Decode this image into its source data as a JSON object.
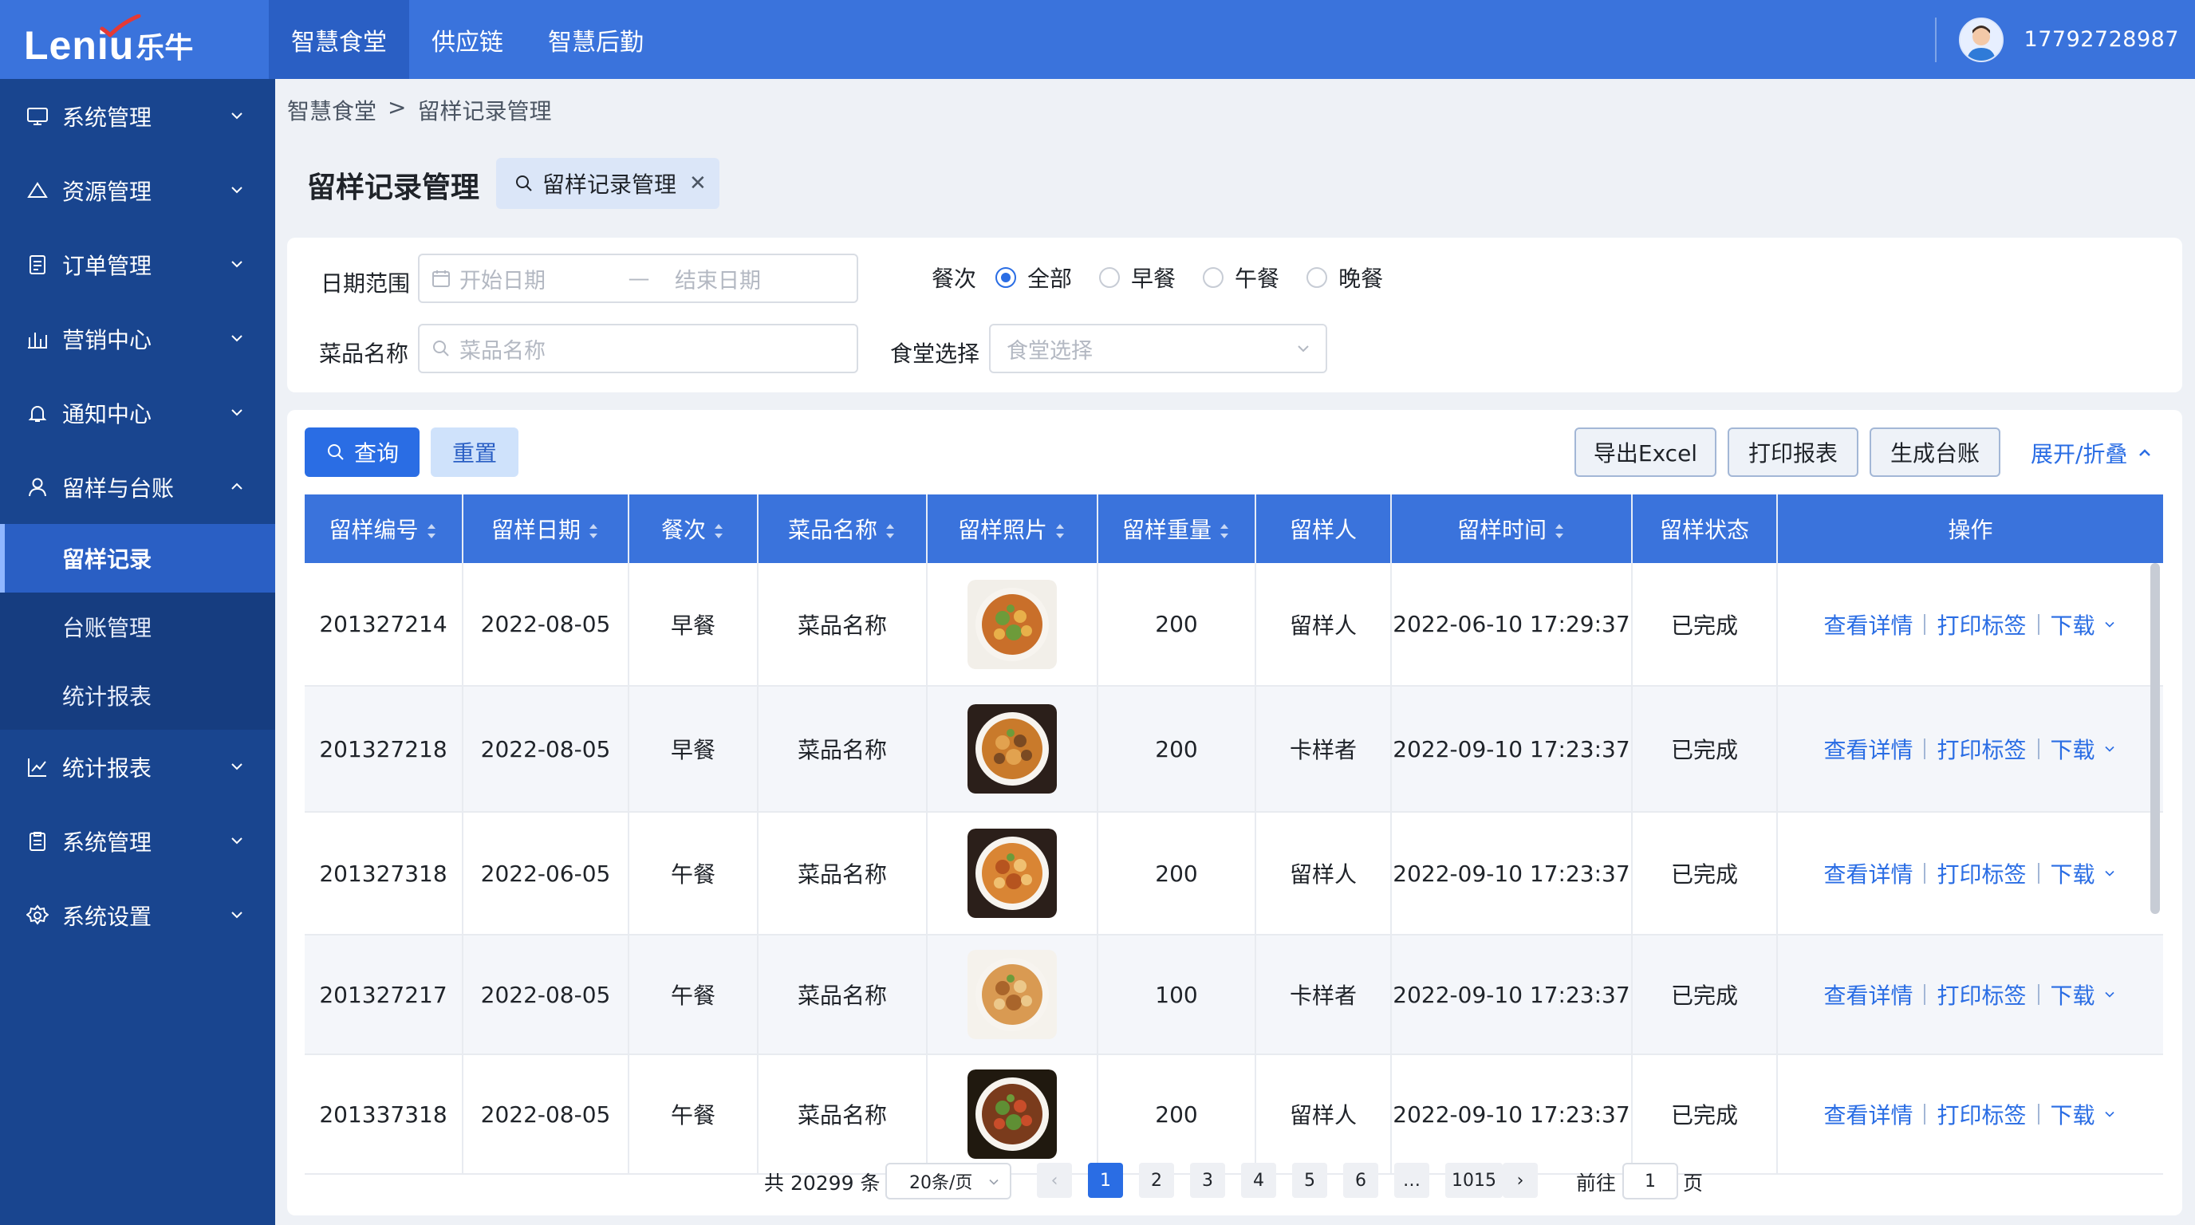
{
  "brand": {
    "latin": "Leniu",
    "cn": "乐牛"
  },
  "topnav": [
    "智慧食堂",
    "供应链",
    "智慧后勤"
  ],
  "user": {
    "phone": "17792728987"
  },
  "sidebar": {
    "items_top": [
      "系统管理",
      "资源管理",
      "订单管理",
      "营销中心",
      "通知中心",
      "留样与台账"
    ],
    "sub_items": [
      "留样记录",
      "台账管理",
      "统计报表"
    ],
    "items_bottom": [
      "统计报表",
      "系统管理",
      "系统设置"
    ]
  },
  "breadcrumb": {
    "root": "智慧食堂",
    "sep": ">",
    "current": "留样记录管理"
  },
  "page": {
    "title": "留样记录管理",
    "tag": "留样记录管理"
  },
  "filters": {
    "date_label": "日期范围",
    "start_placeholder": "开始日期",
    "dash": "—",
    "end_placeholder": "结束日期",
    "meal_label": "餐次",
    "meal_options": [
      "全部",
      "早餐",
      "午餐",
      "晚餐"
    ],
    "meal_selected": "全部",
    "dish_label": "菜品名称",
    "dish_placeholder": "菜品名称",
    "canteen_label": "食堂选择",
    "canteen_placeholder": "食堂选择"
  },
  "actions": {
    "query": "查询",
    "reset": "重置",
    "export": "导出Excel",
    "print": "打印报表",
    "ledger": "生成台账",
    "expand": "展开/折叠"
  },
  "table": {
    "columns": [
      "留样编号",
      "留样日期",
      "餐次",
      "菜品名称",
      "留样照片",
      "留样重量",
      "留样人",
      "留样时间",
      "留样状态",
      "操作"
    ],
    "rows": [
      [
        "201327214",
        "2022-08-05",
        "早餐",
        "菜品名称",
        "",
        "200",
        "留样人",
        "2022-06-10 17:29:37",
        "已完成"
      ],
      [
        "201327218",
        "2022-08-05",
        "早餐",
        "菜品名称",
        "",
        "200",
        "卡样者",
        "2022-09-10 17:23:37",
        "已完成"
      ],
      [
        "201327318",
        "2022-06-05",
        "午餐",
        "菜品名称",
        "",
        "200",
        "留样人",
        "2022-09-10 17:23:37",
        "已完成"
      ],
      [
        "201327217",
        "2022-08-05",
        "午餐",
        "菜品名称",
        "",
        "100",
        "卡样者",
        "2022-09-10 17:23:37",
        "已完成"
      ],
      [
        "201337318",
        "2022-08-05",
        "午餐",
        "菜品名称",
        "",
        "200",
        "留样人",
        "2022-09-10 17:23:37",
        "已完成"
      ]
    ],
    "row_actions": {
      "view": "查看详情",
      "print_label": "打印标签",
      "download": "下载"
    }
  },
  "pagination": {
    "total_prefix": "共",
    "total": "20299",
    "total_suffix": "条",
    "page_size": "20条/页",
    "pages": [
      "1",
      "2",
      "3",
      "4",
      "5",
      "6",
      "…",
      "1015"
    ],
    "current": "1",
    "goto_prefix": "前往",
    "goto_value": "1",
    "goto_suffix": "页"
  },
  "colors": {
    "primary": "#2a6de4",
    "topbar": "#3a73dc",
    "sidebar": "#19458f"
  }
}
